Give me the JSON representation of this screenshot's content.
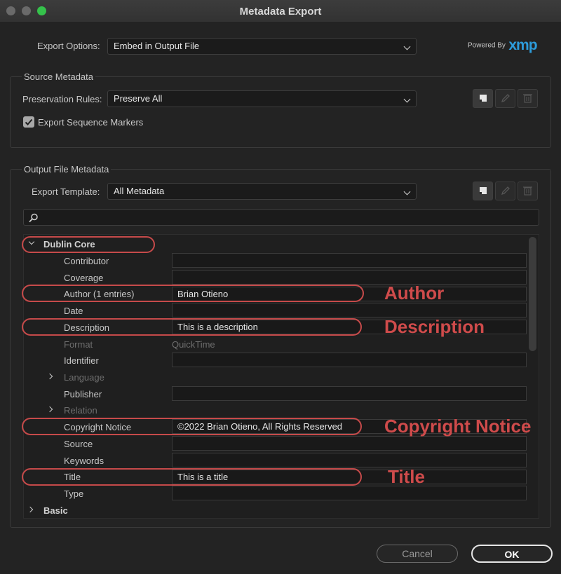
{
  "window": {
    "title": "Metadata Export"
  },
  "export_options": {
    "label": "Export Options:",
    "value": "Embed in Output File"
  },
  "branding": {
    "powered_by": "Powered By",
    "xmp": "xmp"
  },
  "source_metadata": {
    "title": "Source Metadata",
    "preservation_label": "Preservation Rules:",
    "preservation_value": "Preserve All",
    "export_markers_label": "Export Sequence Markers",
    "export_markers_checked": true
  },
  "output_metadata": {
    "title": "Output File Metadata",
    "template_label": "Export Template:",
    "template_value": "All Metadata"
  },
  "search": {
    "placeholder": ""
  },
  "tree": {
    "dublin_core": "Dublin Core",
    "rows": [
      {
        "label": "Contributor",
        "value": ""
      },
      {
        "label": "Coverage",
        "value": ""
      },
      {
        "label": "Author (1 entries)",
        "value": "Brian Otieno"
      },
      {
        "label": "Date",
        "value": ""
      },
      {
        "label": "Description",
        "value": "This is a description"
      },
      {
        "label": "Format",
        "value": "QuickTime"
      },
      {
        "label": "Identifier",
        "value": ""
      },
      {
        "label": "Language",
        "value": ""
      },
      {
        "label": "Publisher",
        "value": ""
      },
      {
        "label": "Relation",
        "value": ""
      },
      {
        "label": "Copyright Notice",
        "value": "©2022 Brian Otieno, All Rights Reserved"
      },
      {
        "label": "Source",
        "value": ""
      },
      {
        "label": "Keywords",
        "value": ""
      },
      {
        "label": "Title",
        "value": "This is a title"
      },
      {
        "label": "Type",
        "value": ""
      }
    ],
    "basic": "Basic"
  },
  "annotations": {
    "author": "Author",
    "description": "Description",
    "copyright": "Copyright Notice",
    "title": "Title"
  },
  "buttons": {
    "cancel": "Cancel",
    "ok": "OK"
  },
  "colors": {
    "annotation": "#c64a4a",
    "background": "#232323"
  }
}
